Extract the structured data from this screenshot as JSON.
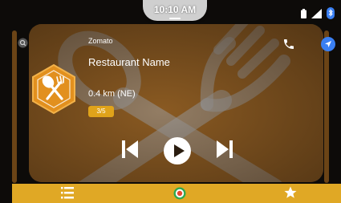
{
  "status_bar": {
    "time": "10:10 AM",
    "icons": [
      "battery-icon",
      "cellular-signal-icon",
      "bluetooth-icon"
    ]
  },
  "card": {
    "source": "Zomato",
    "title": "Restaurant Name",
    "distance": "0.4 km (NE)",
    "rating": "3/5",
    "badge_icon": "fork-spoon-icon",
    "actions": [
      "phone-icon",
      "navigation-arrow-icon"
    ]
  },
  "playback": {
    "controls": [
      "previous-icon",
      "play-icon",
      "next-icon"
    ]
  },
  "bottom_nav": {
    "items": [
      "list-menu-icon",
      "home-circle-icon",
      "star-icon"
    ]
  },
  "colors": {
    "card": "#8a5a22",
    "accent": "#e0a825",
    "badge": "#e2901e",
    "nav_blue": "#3a7ff2"
  }
}
